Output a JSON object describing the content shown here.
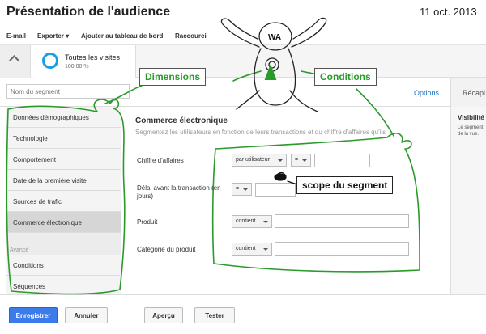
{
  "header": {
    "title": "Présentation de l'audience",
    "date": "11 oct. 2013"
  },
  "toolbar": {
    "email": "E-mail",
    "export": "Exporter",
    "add_dashboard": "Ajouter au tableau de bord",
    "shortcuts": "Raccourci"
  },
  "visits": {
    "label": "Toutes les visites",
    "percent": "100,00 %"
  },
  "segment": {
    "placeholder": "Nom du segment",
    "options": "Options",
    "recap": "Récapi"
  },
  "sidebar": {
    "items": [
      "Données démographiques",
      "Technologie",
      "Comportement",
      "Date de la première visite",
      "Sources de trafic",
      "Commerce électronique"
    ],
    "advanced_label": "Avancé",
    "advanced_items": [
      "Conditions",
      "Séquences"
    ]
  },
  "main": {
    "title": "Commerce électronique",
    "description": "Segmentez les utilisateurs en fonction de leurs transactions et du chiffre d'affaires qu'ils",
    "fields": [
      {
        "label": "Chiffre d'affaires",
        "select1": "par utilisateur",
        "select2": "="
      },
      {
        "label": "Délai avant la transaction (en jours)",
        "select2": "="
      },
      {
        "label": "Produit",
        "select1": "contient"
      },
      {
        "label": "Catégorie du produit",
        "select1": "contient"
      }
    ]
  },
  "right_panel": {
    "title": "Visibilité",
    "text": "Le segment de la vue."
  },
  "footer": {
    "save": "Enregistrer",
    "cancel": "Annuler",
    "preview": "Aperçu",
    "test": "Tester"
  },
  "annotations": {
    "dimensions": "Dimensions",
    "conditions": "Conditions",
    "scope": "scope du segment",
    "logo": "WA"
  },
  "colors": {
    "accent": "#3b7bea",
    "annotation": "#2a9a2a",
    "ring": "#1a9fe0"
  }
}
